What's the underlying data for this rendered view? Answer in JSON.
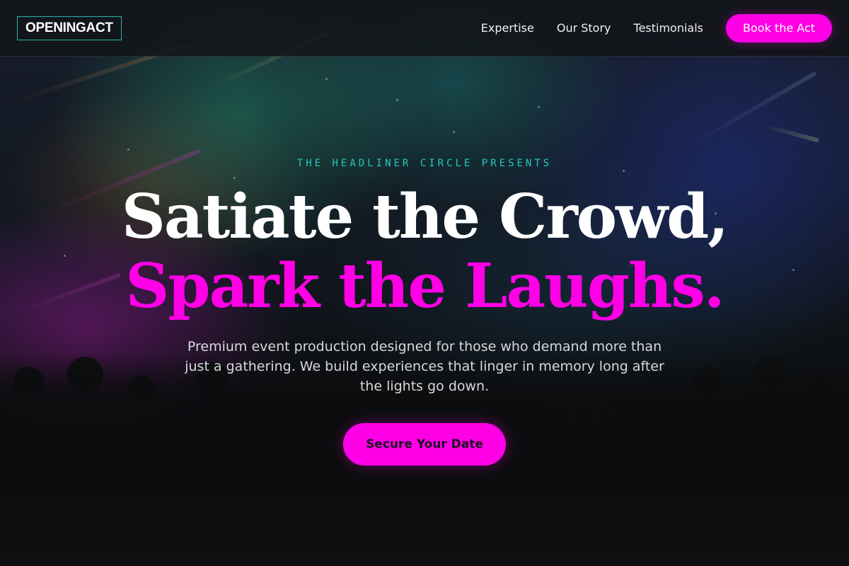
{
  "nav": {
    "logo": "OPENINGACT",
    "links": [
      {
        "label": "Expertise"
      },
      {
        "label": "Our Story"
      },
      {
        "label": "Testimonials"
      }
    ],
    "cta_label": "Book the Act"
  },
  "hero": {
    "eyebrow": "THE HEADLINER CIRCLE PRESENTS",
    "headline_line1": "Satiate the Crowd,",
    "headline_line2": "Spark the Laughs.",
    "subtext": "Premium event production designed for those who demand more than just a gathering. We build experiences that linger in memory long after the lights go down.",
    "cta_label": "Secure Your Date",
    "background": "concert-crowd-image"
  },
  "colors": {
    "accent": "#ff00e6",
    "teal": "#27c7c1",
    "nav_bg": "#121418",
    "page_bg": "#101012"
  }
}
